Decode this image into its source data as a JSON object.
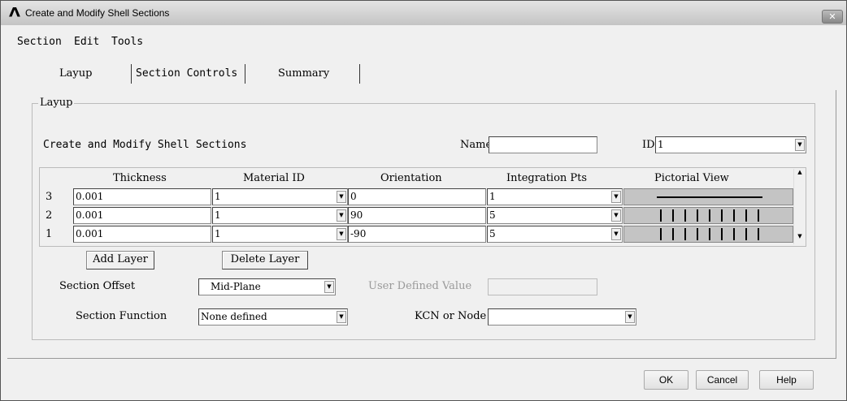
{
  "window": {
    "title": "Create and Modify Shell Sections",
    "logo": "Λ",
    "close": "✕"
  },
  "menu": [
    "Section",
    "Edit",
    "Tools"
  ],
  "tabs": [
    "Layup",
    "Section Controls",
    "Summary"
  ],
  "group": {
    "label": "Layup",
    "heading": "Create and Modify Shell Sections"
  },
  "name": {
    "label": "Name",
    "value": ""
  },
  "id": {
    "label": "ID",
    "value": "1"
  },
  "table": {
    "headers": [
      "Thickness",
      "Material ID",
      "Orientation",
      "Integration Pts",
      "Pictorial View"
    ],
    "rows": [
      {
        "num": "3",
        "thickness": "0.001",
        "material": "1",
        "orientation": "0",
        "intpts": "1",
        "view": "horizontal"
      },
      {
        "num": "2",
        "thickness": "0.001",
        "material": "1",
        "orientation": "90",
        "intpts": "5",
        "view": "vertical"
      },
      {
        "num": "1",
        "thickness": "0.001",
        "material": "1",
        "orientation": "-90",
        "intpts": "5",
        "view": "vertical"
      }
    ]
  },
  "buttons": {
    "add_layer": "Add Layer",
    "delete_layer": "Delete Layer",
    "ok": "OK",
    "cancel": "Cancel",
    "help": "Help"
  },
  "offset": {
    "label": "Section Offset",
    "value": "Mid-Plane",
    "user_label": "User Defined Value",
    "user_value": ""
  },
  "function": {
    "label": "Section Function",
    "value": "None defined",
    "kcn_label": "KCN or Node",
    "kcn_value": ""
  }
}
